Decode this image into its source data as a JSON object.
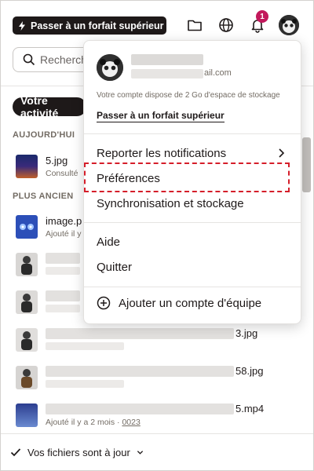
{
  "topbar": {
    "upgrade_label": "Passer à un forfait supérieur",
    "notification_count": "1",
    "icons": [
      "folder-icon",
      "globe-icon",
      "bell-icon"
    ]
  },
  "search": {
    "placeholder": "Recherche"
  },
  "activity": {
    "button_label": "Votre activité",
    "section_today": "AUJOURD'HUI",
    "section_older": "PLUS ANCIEN",
    "files": [
      {
        "name": "5.jpg",
        "sub": "Consulté"
      },
      {
        "name": "image.p",
        "sub": "Ajouté il y"
      },
      {
        "name": "",
        "sub": ""
      },
      {
        "name": "",
        "sub": ""
      },
      {
        "name": "3.jpg",
        "sub": ""
      },
      {
        "name": "58.jpg",
        "sub": ""
      },
      {
        "name": "5.mp4",
        "sub": "Ajouté il y a 2 mois · ",
        "sub_link": "0023"
      }
    ]
  },
  "footer": {
    "status": "Vos fichiers sont à jour"
  },
  "menu": {
    "email_suffix": "ail.com",
    "storage_text": "Votre compte dispose de 2 Go d'espace de stockage",
    "upgrade_link": "Passer à un forfait supérieur",
    "items": {
      "snooze": "Reporter les notifications",
      "preferences": "Préférences",
      "sync": "Synchronisation et stockage",
      "help": "Aide",
      "quit": "Quitter",
      "add_team": "Ajouter un compte d'équipe"
    }
  },
  "colors": {
    "highlight": "#d51e2a",
    "badge": "#c2185b",
    "dark": "#1e1919"
  }
}
